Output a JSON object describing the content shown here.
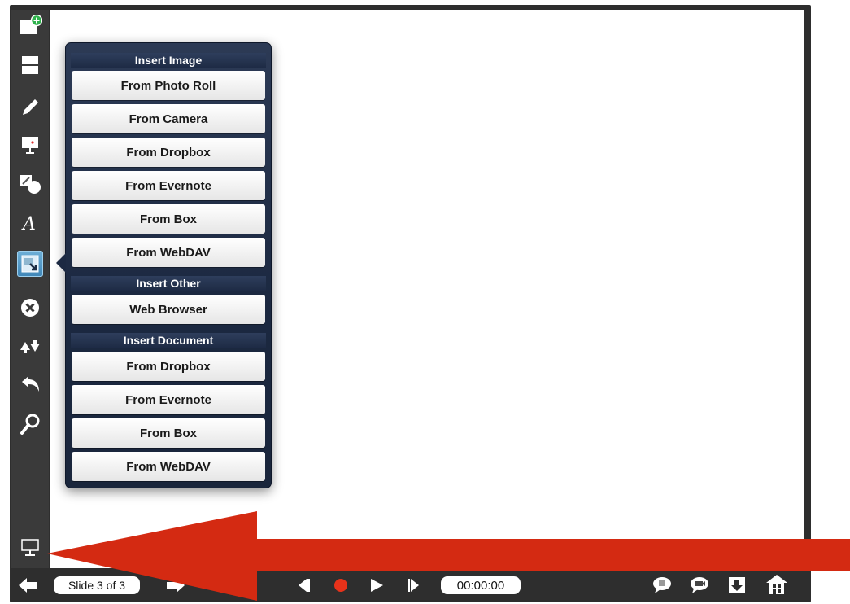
{
  "toolbar": {
    "items": [
      {
        "icon": "add-slide-icon"
      },
      {
        "icon": "layout-icon"
      },
      {
        "icon": "pen-icon"
      },
      {
        "icon": "presenter-icon"
      },
      {
        "icon": "shapes-icon"
      },
      {
        "icon": "text-icon"
      },
      {
        "icon": "insert-image-icon",
        "active": true
      },
      {
        "icon": "delete-icon"
      },
      {
        "icon": "swap-icon"
      },
      {
        "icon": "undo-icon"
      },
      {
        "icon": "zoom-icon"
      }
    ],
    "bottom_icon": "projector-icon"
  },
  "popover": {
    "sections": [
      {
        "title": "Insert Image",
        "items": [
          "From Photo Roll",
          "From Camera",
          "From Dropbox",
          "From Evernote",
          "From Box",
          "From WebDAV"
        ]
      },
      {
        "title": "Insert Other",
        "items": [
          "Web Browser"
        ]
      },
      {
        "title": "Insert Document",
        "items": [
          "From Dropbox",
          "From Evernote",
          "From Box",
          "From WebDAV"
        ]
      }
    ]
  },
  "bottombar": {
    "slide_indicator": "Slide 3 of 3",
    "timer": "00:00:00",
    "right_icons": [
      "comment-icon",
      "chat-icon",
      "download-icon",
      "home-icon"
    ]
  },
  "colors": {
    "overlay_arrow": "#d42a12",
    "active_tool": "#4a90c2",
    "record": "#e8321a"
  }
}
